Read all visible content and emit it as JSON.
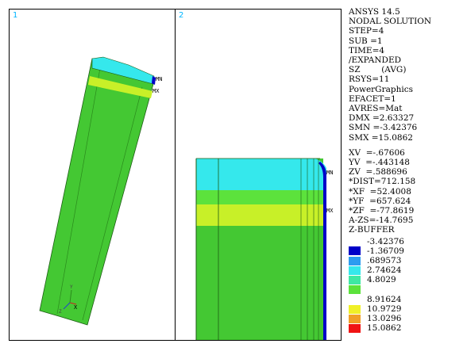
{
  "viewports": [
    {
      "number": "1",
      "labels": {
        "mn": "MN",
        "mx": "MX",
        "triad_x": "X",
        "triad_y": "Y",
        "triad_z": "Z"
      }
    },
    {
      "number": "2",
      "labels": {
        "mn": "MN",
        "mx": "MX"
      }
    }
  ],
  "info": {
    "lines": [
      "ANSYS 14.5",
      "NODAL SOLUTION",
      "STEP=4",
      "SUB =1",
      "TIME=4",
      "/EXPANDED",
      "SZ        (AVG)",
      "RSYS=11",
      "PowerGraphics",
      "EFACET=1",
      "AVRES=Mat",
      "DMX =2.63327",
      "SMN =-3.42376",
      "SMX =15.0862"
    ],
    "view_lines": [
      "XV  =-.67606",
      "YV  =-.443148",
      "ZV  =.588696",
      "*DIST=712.158",
      "*XF  =52.4008",
      "*YF  =657.624",
      "*ZF  =-77.8619",
      "A-ZS=-14.7695",
      "Z-BUFFER"
    ]
  },
  "legend": {
    "entries": [
      {
        "value": "-3.42376",
        "color": ""
      },
      {
        "value": "-1.36709",
        "color": "#0000c8"
      },
      {
        "value": ".689573",
        "color": "#2c9cf0"
      },
      {
        "value": "2.74624",
        "color": "#35e8ec"
      },
      {
        "value": "4.8029",
        "color": "#3ee8a4"
      },
      {
        "value": "",
        "color": "#5ce23c"
      },
      {
        "value": "8.91624",
        "color": ""
      },
      {
        "value": "10.9729",
        "color": "#f0f028"
      },
      {
        "value": "13.0296",
        "color": "#f0a028"
      },
      {
        "value": "15.0862",
        "color": "#f01414"
      }
    ]
  },
  "colors": {
    "green": "#44c833",
    "cyan": "#35e8ec",
    "yellow": "#c8f028",
    "blue": "#0000c8"
  }
}
